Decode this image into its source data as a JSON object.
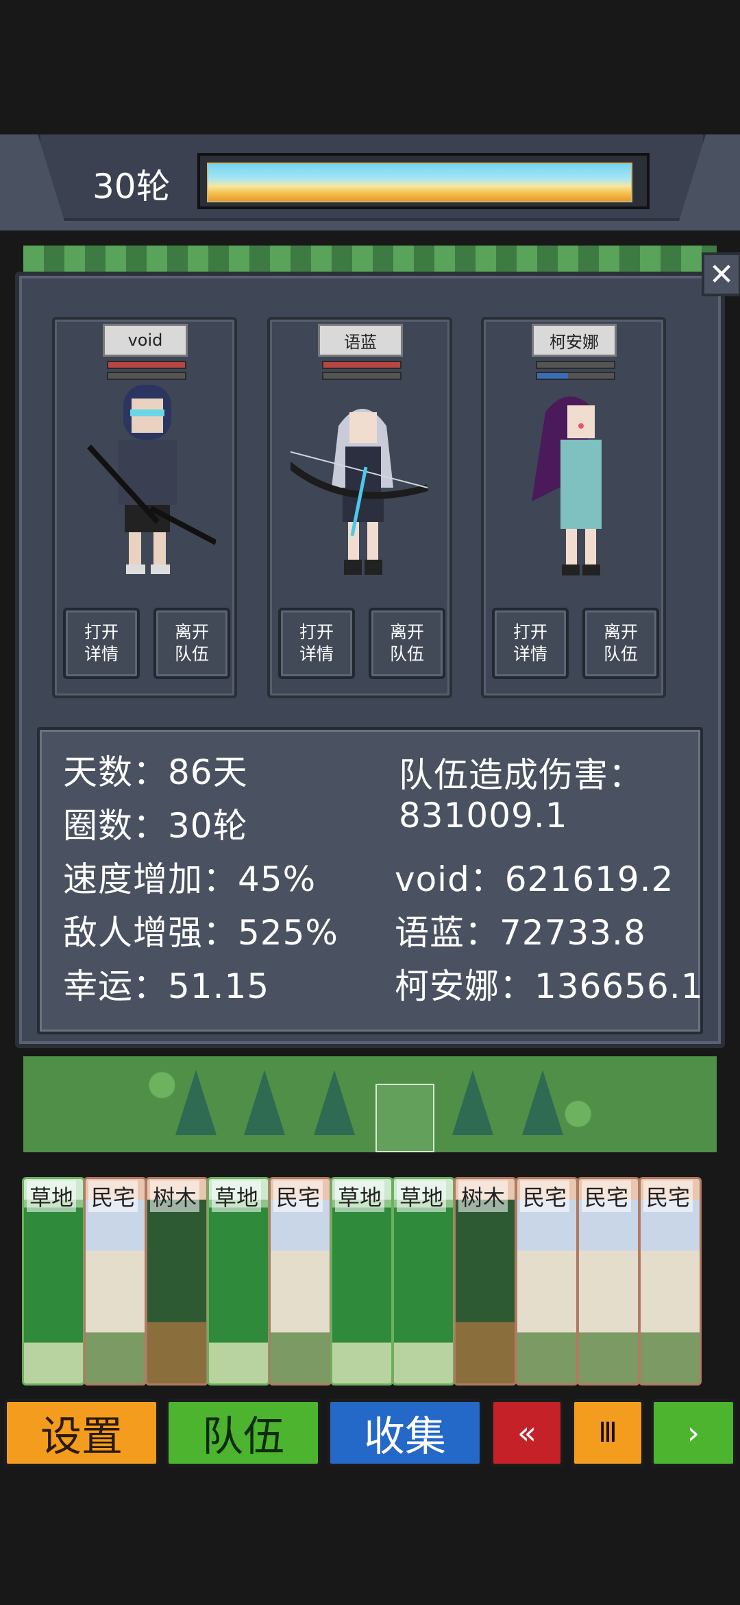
{
  "header": {
    "round_label": "30轮",
    "progress_fraction": 0.97
  },
  "dialog": {
    "close_symbol": "✕"
  },
  "party": [
    {
      "name": "void",
      "hp_fraction": 1.0,
      "hp_color": "#b94545",
      "mp_fraction": 0.0,
      "mp_color": "#3a6db8",
      "open_label_1": "打开",
      "open_label_2": "详情",
      "leave_label_1": "离开",
      "leave_label_2": "队伍",
      "hair_color": "#2c3560",
      "outfit_color": "#3a4052",
      "accent_color": "#6ad6e8"
    },
    {
      "name": "语蓝",
      "hp_fraction": 1.0,
      "hp_color": "#b94545",
      "mp_fraction": 0.0,
      "mp_color": "#3a6db8",
      "open_label_1": "打开",
      "open_label_2": "详情",
      "leave_label_1": "离开",
      "leave_label_2": "队伍",
      "hair_color": "#c9ccd8",
      "outfit_color": "#2b2f40",
      "accent_color": "#4cc9e8"
    },
    {
      "name": "柯安娜",
      "hp_fraction": 0.0,
      "hp_color": "#b94545",
      "mp_fraction": 0.4,
      "mp_color": "#3a6db8",
      "open_label_1": "打开",
      "open_label_2": "详情",
      "leave_label_1": "离开",
      "leave_label_2": "队伍",
      "hair_color": "#4a1a5a",
      "outfit_color": "#7fc0c0",
      "accent_color": "#e05a6a"
    }
  ],
  "stats": {
    "days": "天数：86天",
    "laps": "圈数：30轮",
    "speed": "速度增加：45%",
    "enemy": "敌人增强：525%",
    "luck": "幸运：51.15",
    "team_damage_label": "队伍造成伤害：",
    "team_damage_value": "831009.1",
    "void_damage": "void：621619.2",
    "yulan_damage": "语蓝：72733.8",
    "keanna_damage": "柯安娜：136656.1"
  },
  "hand": [
    {
      "label": "草地",
      "kind": "grass"
    },
    {
      "label": "民宅",
      "kind": "house"
    },
    {
      "label": "树木",
      "kind": "wood"
    },
    {
      "label": "草地",
      "kind": "grass"
    },
    {
      "label": "民宅",
      "kind": "house"
    },
    {
      "label": "草地",
      "kind": "grass"
    },
    {
      "label": "草地",
      "kind": "grass"
    },
    {
      "label": "树木",
      "kind": "wood"
    },
    {
      "label": "民宅",
      "kind": "house"
    },
    {
      "label": "民宅",
      "kind": "house"
    },
    {
      "label": "民宅",
      "kind": "house"
    }
  ],
  "menu": {
    "settings": "设置",
    "team": "队伍",
    "collect": "收集",
    "rewind": "«",
    "pause": "Ⅲ",
    "next": "›"
  }
}
